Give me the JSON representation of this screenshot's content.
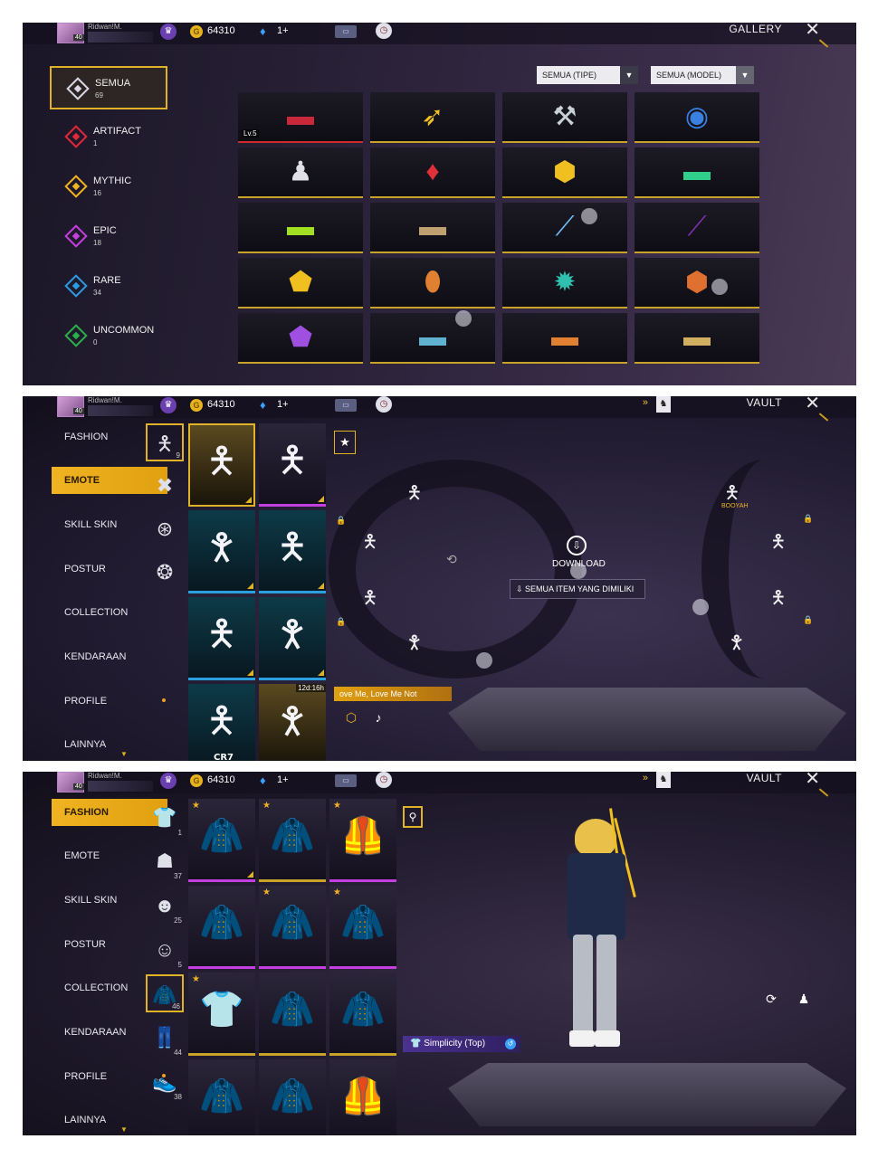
{
  "player": {
    "name": "Ridwan!M.",
    "level": "40",
    "coins": "64310",
    "diamonds": "1+"
  },
  "panel1": {
    "title": "GALLERY",
    "rarities": [
      {
        "label": "SEMUA",
        "count": "69",
        "color": "#d8d8e8"
      },
      {
        "label": "ARTIFACT",
        "count": "1",
        "color": "#e0283a"
      },
      {
        "label": "MYTHIC",
        "count": "16",
        "color": "#f0b321"
      },
      {
        "label": "EPIC",
        "count": "18",
        "color": "#c43fe0"
      },
      {
        "label": "RARE",
        "count": "34",
        "color": "#2a9be0"
      },
      {
        "label": "UNCOMMON",
        "count": "0",
        "color": "#2ab04a"
      }
    ],
    "filter_type": "SEMUA (TIPE)",
    "filter_model": "SEMUA (MODEL)",
    "first_item_level": "Lv.5",
    "items": [
      {
        "icon": "red-rifle-icon",
        "glyph": "▬",
        "color": "#c8283a"
      },
      {
        "icon": "gold-lance-icon",
        "glyph": "➶",
        "color": "#f0c020"
      },
      {
        "icon": "scythe-icon",
        "glyph": "⚒",
        "color": "#c8d0d8"
      },
      {
        "icon": "lantern-icon",
        "glyph": "◉",
        "color": "#3a80e0"
      },
      {
        "icon": "bunny-grenade-icon",
        "glyph": "♟",
        "color": "#e0e0e8"
      },
      {
        "icon": "red-crystal-icon",
        "glyph": "♦",
        "color": "#e0303a"
      },
      {
        "icon": "gold-helmet-icon",
        "glyph": "⬢",
        "color": "#f0c020"
      },
      {
        "icon": "green-rifle-icon",
        "glyph": "▬",
        "color": "#30d08a"
      },
      {
        "icon": "lime-smg-icon",
        "glyph": "▬",
        "color": "#a0e020"
      },
      {
        "icon": "ornate-rifle-icon",
        "glyph": "▬",
        "color": "#c0a070"
      },
      {
        "icon": "blade-icon",
        "glyph": "⟋",
        "color": "#70c0ff"
      },
      {
        "icon": "purple-scythe-icon",
        "glyph": "⟋",
        "color": "#8030b0"
      },
      {
        "icon": "gold-armor-icon",
        "glyph": "⬟",
        "color": "#f0c020"
      },
      {
        "icon": "rainbow-grenade-icon",
        "glyph": "⬮",
        "color": "#e08030"
      },
      {
        "icon": "teal-spiked-icon",
        "glyph": "✹",
        "color": "#30c0b0"
      },
      {
        "icon": "flame-helmet-icon",
        "glyph": "⬢",
        "color": "#e07030"
      },
      {
        "icon": "purple-mask-icon",
        "glyph": "⬟",
        "color": "#a050e0"
      },
      {
        "icon": "ak-rifle-icon",
        "glyph": "▬",
        "color": "#60b0d0"
      },
      {
        "icon": "flame-rifle-icon",
        "glyph": "▬",
        "color": "#e08030"
      },
      {
        "icon": "sniper-rifle-icon",
        "glyph": "▬",
        "color": "#d0b060"
      }
    ]
  },
  "panel2": {
    "title": "VAULT",
    "categories": [
      "FASHION",
      "EMOTE",
      "SKILL SKIN",
      "POSTUR",
      "COLLECTION",
      "KENDARAAN",
      "PROFILE",
      "LAINNYA"
    ],
    "sub_tab_count": "9",
    "download_label": "DOWNLOAD",
    "owned_label": "SEMUA ITEM YANG DIMILIKI",
    "emote_name": "ove Me, Love Me Not",
    "timer": "12d:16h",
    "tile_caption": "CR7",
    "booyah": "BOOYAH"
  },
  "panel3": {
    "title": "VAULT",
    "categories": [
      "FASHION",
      "EMOTE",
      "SKILL SKIN",
      "POSTUR",
      "COLLECTION",
      "KENDARAAN",
      "PROFILE",
      "LAINNYA"
    ],
    "sub_counts": [
      "1",
      "37",
      "25",
      "5",
      "46",
      "44",
      "38"
    ],
    "outfit_name": "Simplicity (Top)"
  }
}
